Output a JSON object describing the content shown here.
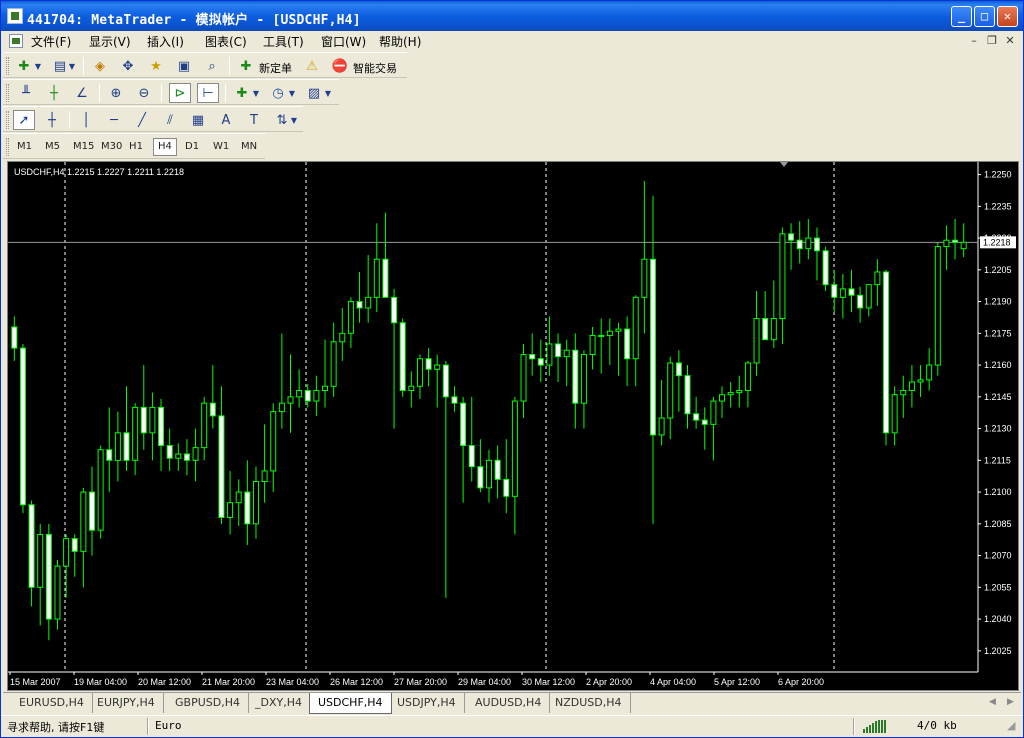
{
  "window": {
    "title": "441704: MetaTrader - 模拟帐户 - [USDCHF,H4]",
    "minimize": "_",
    "maximize": "□",
    "close": "✕"
  },
  "menu": {
    "items": [
      {
        "label": "文件(F)"
      },
      {
        "label": "显示(V)"
      },
      {
        "label": "插入(I)"
      },
      {
        "label": "图表(C)"
      },
      {
        "label": "工具(T)"
      },
      {
        "label": "窗口(W)"
      },
      {
        "label": "帮助(H)"
      }
    ],
    "mdi_min": "–",
    "mdi_restore": "❐",
    "mdi_close": "✕"
  },
  "toolbar1": {
    "new_order_label": "新定单",
    "expert_label": "智能交易"
  },
  "timeframes": [
    "M1",
    "M5",
    "M15",
    "M30",
    "H1",
    "H4",
    "D1",
    "W1",
    "MN"
  ],
  "active_timeframe": "H4",
  "chart": {
    "header": "USDCHF,H4  1.2215 1.2227 1.2211 1.2218",
    "current_price": "1.2218",
    "bg_color": "#000000",
    "candle_color": "#00ff00",
    "bull_fill": "#000000",
    "bear_fill": "#ffffff"
  },
  "chart_data": {
    "type": "candlestick",
    "symbol": "USDCHF",
    "timeframe": "H4",
    "ylim": [
      1.2015,
      1.2255
    ],
    "y_ticks": [
      "1.2250",
      "1.2235",
      "1.2220",
      "1.2205",
      "1.2190",
      "1.2175",
      "1.2160",
      "1.2145",
      "1.2130",
      "1.2115",
      "1.2100",
      "1.2085",
      "1.2070",
      "1.2055",
      "1.2040",
      "1.2025"
    ],
    "x_ticks": [
      "15 Mar 2007",
      "19 Mar 04:00",
      "20 Mar 12:00",
      "21 Mar 20:00",
      "23 Mar 04:00",
      "26 Mar 12:00",
      "27 Mar 20:00",
      "29 Mar 04:00",
      "30 Mar 12:00",
      "2 Apr 20:00",
      "4 Apr 04:00",
      "5 Apr 12:00",
      "6 Apr 20:00"
    ],
    "last": 1.2218,
    "candles": [
      [
        1.2178,
        1.2183,
        1.2162,
        1.2168
      ],
      [
        1.2168,
        1.217,
        1.209,
        1.2094
      ],
      [
        1.2094,
        1.2096,
        1.2046,
        1.2055
      ],
      [
        1.2055,
        1.2085,
        1.2037,
        1.208
      ],
      [
        1.208,
        1.2085,
        1.203,
        1.204
      ],
      [
        1.204,
        1.2068,
        1.2035,
        1.2065
      ],
      [
        1.2065,
        1.208,
        1.205,
        1.2078
      ],
      [
        1.2078,
        1.208,
        1.206,
        1.2072
      ],
      [
        1.2072,
        1.2102,
        1.2055,
        1.21
      ],
      [
        1.21,
        1.2112,
        1.207,
        1.2082
      ],
      [
        1.2082,
        1.2122,
        1.2078,
        1.212
      ],
      [
        1.212,
        1.214,
        1.21,
        1.2115
      ],
      [
        1.2115,
        1.2138,
        1.2105,
        1.2128
      ],
      [
        1.2128,
        1.215,
        1.211,
        1.2115
      ],
      [
        1.2115,
        1.2142,
        1.2108,
        1.214
      ],
      [
        1.214,
        1.216,
        1.212,
        1.2128
      ],
      [
        1.2128,
        1.2147,
        1.2115,
        1.214
      ],
      [
        1.214,
        1.2144,
        1.211,
        1.2122
      ],
      [
        1.2122,
        1.213,
        1.211,
        1.2116
      ],
      [
        1.2116,
        1.2123,
        1.211,
        1.2118
      ],
      [
        1.2118,
        1.2125,
        1.2108,
        1.2115
      ],
      [
        1.2115,
        1.213,
        1.2105,
        1.2121
      ],
      [
        1.2121,
        1.2145,
        1.2115,
        1.2142
      ],
      [
        1.2142,
        1.216,
        1.213,
        1.2136
      ],
      [
        1.2136,
        1.215,
        1.2085,
        1.2088
      ],
      [
        1.2088,
        1.211,
        1.208,
        1.2095
      ],
      [
        1.2095,
        1.2106,
        1.2084,
        1.21
      ],
      [
        1.21,
        1.2115,
        1.2075,
        1.2085
      ],
      [
        1.2085,
        1.2112,
        1.2078,
        1.2105
      ],
      [
        1.2105,
        1.2132,
        1.2095,
        1.211
      ],
      [
        1.211,
        1.2142,
        1.21,
        1.2138
      ],
      [
        1.2138,
        1.2175,
        1.213,
        1.2142
      ],
      [
        1.2142,
        1.2165,
        1.2128,
        1.2145
      ],
      [
        1.2145,
        1.2158,
        1.214,
        1.2148
      ],
      [
        1.2148,
        1.2151,
        1.214,
        1.2143
      ],
      [
        1.2143,
        1.2155,
        1.2136,
        1.2148
      ],
      [
        1.2148,
        1.2172,
        1.214,
        1.215
      ],
      [
        1.215,
        1.218,
        1.2145,
        1.2171
      ],
      [
        1.2171,
        1.2187,
        1.2162,
        1.2175
      ],
      [
        1.2175,
        1.2192,
        1.2168,
        1.219
      ],
      [
        1.219,
        1.2204,
        1.218,
        1.2187
      ],
      [
        1.2187,
        1.2212,
        1.218,
        1.2192
      ],
      [
        1.2192,
        1.2227,
        1.2185,
        1.221
      ],
      [
        1.221,
        1.2232,
        1.2195,
        1.2192
      ],
      [
        1.2192,
        1.2196,
        1.213,
        1.218
      ],
      [
        1.218,
        1.2182,
        1.2145,
        1.2148
      ],
      [
        1.2148,
        1.2157,
        1.214,
        1.215
      ],
      [
        1.215,
        1.2165,
        1.2144,
        1.2163
      ],
      [
        1.2163,
        1.2168,
        1.215,
        1.2158
      ],
      [
        1.2158,
        1.2165,
        1.214,
        1.216
      ],
      [
        1.216,
        1.2162,
        1.205,
        1.2145
      ],
      [
        1.2145,
        1.215,
        1.2138,
        1.2142
      ],
      [
        1.2142,
        1.2145,
        1.2095,
        1.2122
      ],
      [
        1.2122,
        1.2145,
        1.2105,
        1.2112
      ],
      [
        1.2112,
        1.2125,
        1.21,
        1.2102
      ],
      [
        1.2102,
        1.212,
        1.2095,
        1.2115
      ],
      [
        1.2115,
        1.2122,
        1.2097,
        1.2106
      ],
      [
        1.2106,
        1.2125,
        1.209,
        1.2098
      ],
      [
        1.2098,
        1.2145,
        1.208,
        1.2143
      ],
      [
        1.2143,
        1.217,
        1.2135,
        1.2165
      ],
      [
        1.2165,
        1.2175,
        1.2155,
        1.2163
      ],
      [
        1.2163,
        1.2172,
        1.2152,
        1.216
      ],
      [
        1.216,
        1.2183,
        1.2155,
        1.217
      ],
      [
        1.217,
        1.2175,
        1.2152,
        1.2164
      ],
      [
        1.2164,
        1.2172,
        1.215,
        1.2167
      ],
      [
        1.2167,
        1.2175,
        1.213,
        1.2142
      ],
      [
        1.2142,
        1.2167,
        1.213,
        1.2165
      ],
      [
        1.2165,
        1.2178,
        1.2158,
        1.2174
      ],
      [
        1.2174,
        1.2182,
        1.2156,
        1.2174
      ],
      [
        1.2174,
        1.2182,
        1.216,
        1.2176
      ],
      [
        1.2176,
        1.218,
        1.2155,
        1.2177
      ],
      [
        1.2177,
        1.2183,
        1.215,
        1.2163
      ],
      [
        1.2163,
        1.2193,
        1.215,
        1.2192
      ],
      [
        1.2192,
        1.2247,
        1.2175,
        1.221
      ],
      [
        1.221,
        1.224,
        1.2085,
        1.2127
      ],
      [
        1.2127,
        1.2153,
        1.2122,
        1.2135
      ],
      [
        1.2135,
        1.2164,
        1.2125,
        1.2161
      ],
      [
        1.2161,
        1.2167,
        1.2138,
        1.2155
      ],
      [
        1.2155,
        1.216,
        1.213,
        1.2137
      ],
      [
        1.2137,
        1.2145,
        1.213,
        1.2134
      ],
      [
        1.2134,
        1.214,
        1.212,
        1.2132
      ],
      [
        1.2132,
        1.2145,
        1.2115,
        1.2143
      ],
      [
        1.2143,
        1.215,
        1.2135,
        1.2146
      ],
      [
        1.2146,
        1.2152,
        1.214,
        1.2147
      ],
      [
        1.2147,
        1.2155,
        1.214,
        1.2148
      ],
      [
        1.2148,
        1.2162,
        1.214,
        1.2161
      ],
      [
        1.2161,
        1.2195,
        1.2155,
        1.2182
      ],
      [
        1.2182,
        1.2195,
        1.2175,
        1.2172
      ],
      [
        1.2172,
        1.22,
        1.2168,
        1.2182
      ],
      [
        1.2182,
        1.2225,
        1.217,
        1.2222
      ],
      [
        1.2222,
        1.2227,
        1.2205,
        1.2219
      ],
      [
        1.2219,
        1.2228,
        1.2208,
        1.2215
      ],
      [
        1.2215,
        1.2229,
        1.221,
        1.222
      ],
      [
        1.222,
        1.2225,
        1.22,
        1.2214
      ],
      [
        1.2214,
        1.2216,
        1.2195,
        1.2198
      ],
      [
        1.2198,
        1.2205,
        1.2185,
        1.2192
      ],
      [
        1.2192,
        1.2203,
        1.2182,
        1.2196
      ],
      [
        1.2196,
        1.2205,
        1.2185,
        1.2193
      ],
      [
        1.2193,
        1.2197,
        1.218,
        1.2187
      ],
      [
        1.2187,
        1.2196,
        1.2183,
        1.2198
      ],
      [
        1.2198,
        1.221,
        1.2188,
        1.2204
      ],
      [
        1.2204,
        1.2205,
        1.2122,
        1.2128
      ],
      [
        1.2128,
        1.215,
        1.2122,
        1.2146
      ],
      [
        1.2146,
        1.2155,
        1.2135,
        1.2148
      ],
      [
        1.2148,
        1.216,
        1.214,
        1.2152
      ],
      [
        1.2152,
        1.216,
        1.2145,
        1.2153
      ],
      [
        1.2153,
        1.2168,
        1.2148,
        1.216
      ],
      [
        1.216,
        1.2218,
        1.2155,
        1.2216
      ],
      [
        1.2216,
        1.2226,
        1.2205,
        1.2219
      ],
      [
        1.2219,
        1.2229,
        1.221,
        1.2218
      ],
      [
        1.2215,
        1.2227,
        1.2211,
        1.2218
      ]
    ]
  },
  "tabs": [
    "EURUSD,H4",
    "EURJPY,H4",
    "GBPUSD,H4",
    "_DXY,H4",
    "USDCHF,H4",
    "USDJPY,H4",
    "AUDUSD,H4",
    "NZDUSD,H4"
  ],
  "active_tab": "USDCHF,H4",
  "status": {
    "help": "寻求帮助, 请按F1键",
    "profile": "Euro",
    "traffic": "4/0 kb"
  }
}
